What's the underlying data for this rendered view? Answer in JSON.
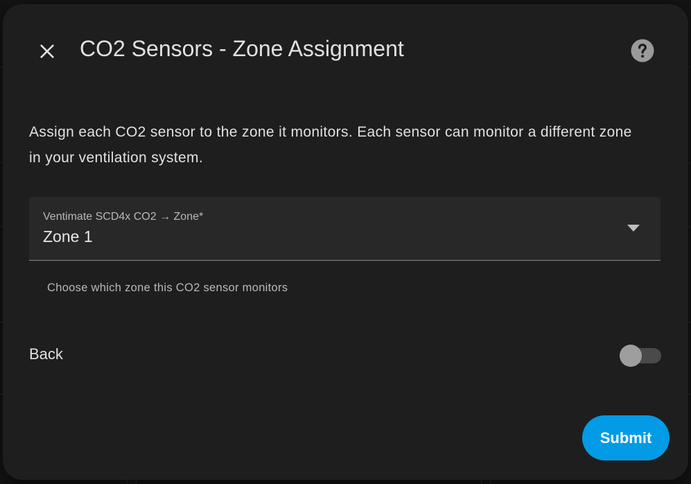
{
  "dialog": {
    "title": "CO2 Sensors - Zone Assignment",
    "description": "Assign each CO2 sensor to the zone it monitors. Each sensor can monitor a different zone in your ventilation system.",
    "close_icon": "close-icon",
    "help_icon": "help-circle-icon"
  },
  "zone_select": {
    "label": "Ventimate SCD4x CO2 → Zone*",
    "value": "Zone 1",
    "helper": "Choose which zone this CO2 sensor monitors",
    "arrow_icon": "dropdown-arrow-icon"
  },
  "back": {
    "label": "Back",
    "checked": false
  },
  "submit": {
    "label": "Submit"
  },
  "colors": {
    "dialog_bg": "#1e1e1e",
    "text": "#e1e1e1",
    "secondary_text": "#b9b9b9",
    "field_bg": "#282828",
    "primary": "#039be5",
    "toggle_track": "#4a4a4a",
    "toggle_thumb": "#9e9e9e"
  }
}
